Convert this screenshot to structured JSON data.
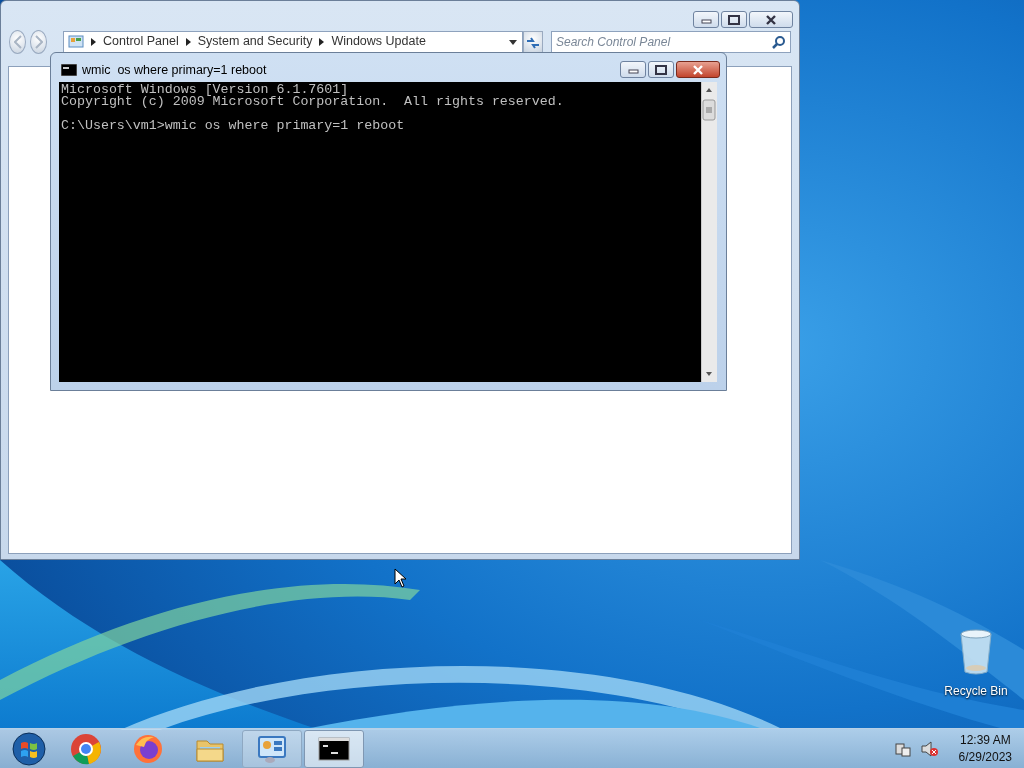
{
  "control_panel": {
    "breadcrumb": [
      "Control Panel",
      "System and Security",
      "Windows Update"
    ],
    "search": {
      "placeholder": "Search Control Panel"
    }
  },
  "console": {
    "title": "wmic  os where primary=1 reboot",
    "output": [
      "Microsoft Windows [Version 6.1.7601]",
      "Copyright (c) 2009 Microsoft Corporation.  All rights reserved."
    ],
    "command_line": "C:\\Users\\vm1>wmic os where primary=1 reboot"
  },
  "desktop_icons": [
    {
      "label": "Recycle Bin"
    }
  ],
  "taskbar": {
    "items": [
      {
        "kind": "chrome",
        "open": false,
        "selected": false
      },
      {
        "kind": "firefox",
        "open": false,
        "selected": false
      },
      {
        "kind": "explorer",
        "open": false,
        "selected": false
      },
      {
        "kind": "control-panel",
        "open": true,
        "selected": false
      },
      {
        "kind": "console",
        "open": true,
        "selected": true
      }
    ],
    "clock": {
      "time": "12:39 AM",
      "date": "6/29/2023"
    }
  }
}
